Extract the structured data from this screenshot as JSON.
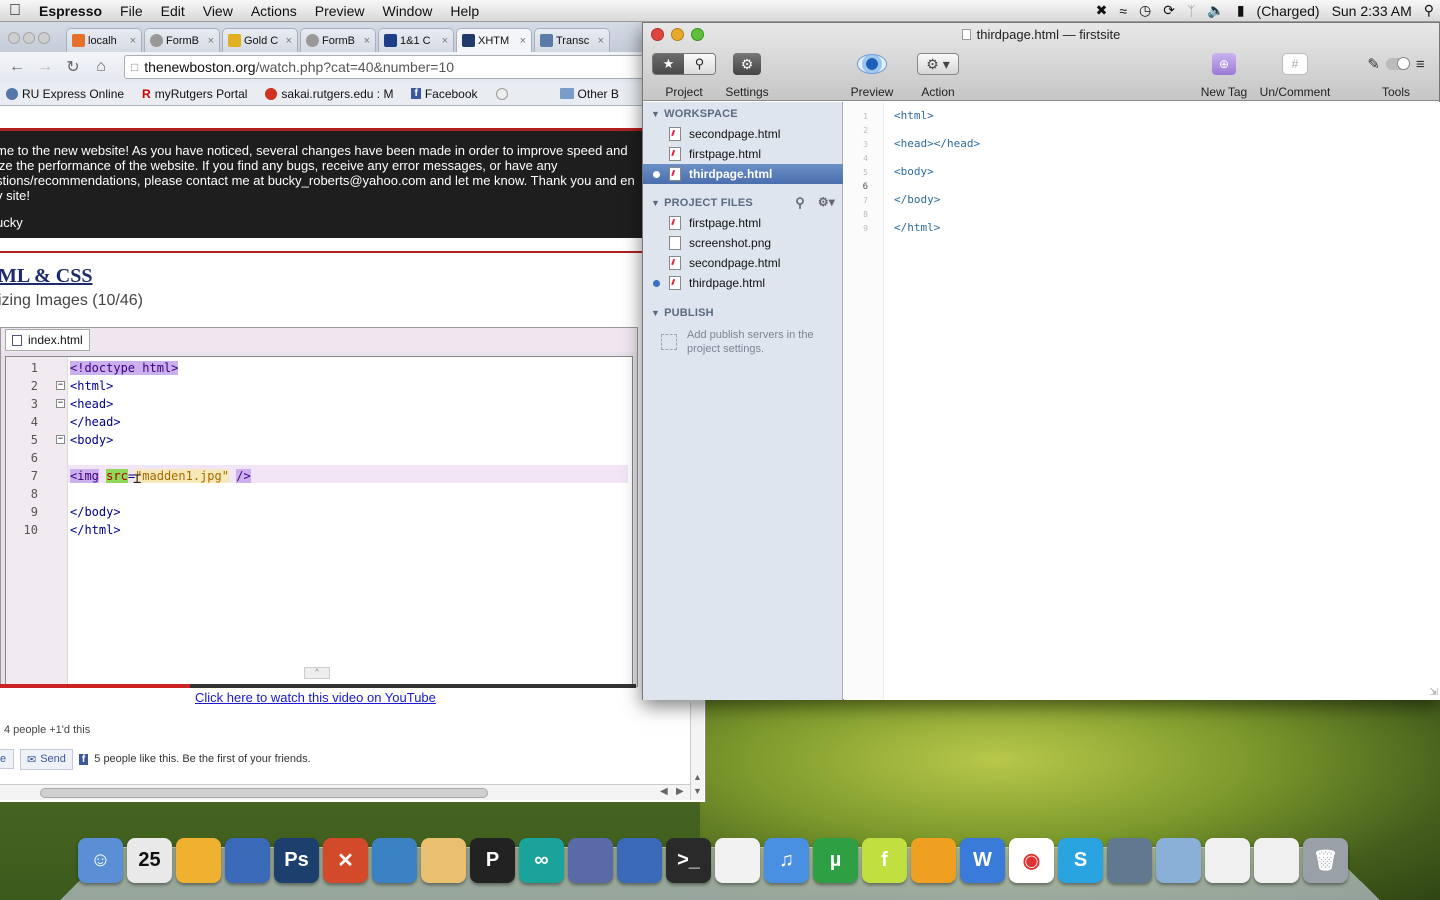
{
  "menubar": {
    "app": "Espresso",
    "items": [
      "File",
      "Edit",
      "View",
      "Actions",
      "Preview",
      "Window",
      "Help"
    ],
    "battery": "(Charged)",
    "clock": "Sun 2:33 AM"
  },
  "browser": {
    "tabs": [
      "localh",
      "FormB",
      "Gold C",
      "FormB",
      "1&1 C",
      "XHTM",
      "Transc"
    ],
    "url_host": "thenewboston.org",
    "url_path": "/watch.php?cat=40&number=10",
    "bookmarks": [
      "RU Express Online",
      "myRutgers Portal",
      "sakai.rutgers.edu : M",
      "Facebook",
      "",
      "Other B"
    ],
    "banner": {
      "lines": [
        "me to the new website! As you have noticed, several changes have been made in order to improve speed and",
        "ize the performance of the website. If you find any bugs, receive any error messages, or have any",
        "stions/recommendations, please contact me at bucky_roberts@yahoo.com and let me know. Thank you and en",
        "v site!"
      ],
      "signature": "ucky"
    },
    "course_title": "ML & CSS",
    "lesson_title": "izing Images (10/46)",
    "video": {
      "tab_label": "index.html",
      "line_numbers": [
        "1",
        "2",
        "3",
        "4",
        "5",
        "6",
        "7",
        "8",
        "9",
        "10"
      ],
      "code": {
        "l1": "<!doctype html>",
        "l2": "<html>",
        "l3": "<head>",
        "l4": "</head>",
        "l5": "<body>",
        "l7_tag": "<img",
        "l7_attr": "src",
        "l7_eq": "=",
        "l7_str": "\"madden1.jpg\"",
        "l7_close": "/>",
        "l9": "</body>",
        "l10": "</html>"
      }
    },
    "youtube_link": "Click here to watch this video on YouTube",
    "plusone_text": "4 people +1'd this",
    "send_label": "Send",
    "like_text": "5 people like this. Be the first of your friends."
  },
  "espresso": {
    "title": "thirdpage.html — firstsite",
    "toolbar": {
      "project": "Project",
      "settings": "Settings",
      "preview": "Preview",
      "action": "Action",
      "new_tag": "New Tag",
      "uncomment": "Un/Comment",
      "tools": "Tools"
    },
    "workspace_label": "WORKSPACE",
    "workspace_files": [
      "secondpage.html",
      "firstpage.html",
      "thirdpage.html"
    ],
    "project_files_label": "PROJECT FILES",
    "project_files": [
      "firstpage.html",
      "screenshot.png",
      "secondpage.html",
      "thirdpage.html"
    ],
    "publish_label": "PUBLISH",
    "publish_note": "Add publish servers in the project settings.",
    "editor_line_numbers": [
      "1",
      "2",
      "3",
      "4",
      "5",
      "6",
      "7",
      "8",
      "9"
    ],
    "editor_code": {
      "l1": "<html>",
      "l3": "<head></head>",
      "l5": "<body>",
      "l7": "</body>",
      "l9": "</html>"
    }
  },
  "dock": {
    "icons": [
      "finder-icon",
      "calendar-icon",
      "preview-icon",
      "imovie-icon",
      "photoshop-icon",
      "xampp-icon",
      "dreamweaver-icon",
      "java-icon",
      "processing-icon",
      "arduino-icon",
      "eclipse-icon",
      "xcode-icon",
      "terminal-icon",
      "textedit-icon",
      "itunes-icon",
      "utorrent-icon",
      "flash-icon",
      "illustrator-icon",
      "word-icon",
      "chrome-icon",
      "skype-icon",
      "camera-icon",
      "folder-icon",
      "document-icon",
      "document-icon-2",
      "trash-icon"
    ],
    "calendar_day": "25",
    "colors": [
      "#5a8fd6",
      "#e9e9e9",
      "#f0b030",
      "#3a6ab8",
      "#1c3f6e",
      "#d24a2a",
      "#3b82c4",
      "#e8c070",
      "#222222",
      "#1aa39a",
      "#5a6aa8",
      "#3a6ab8",
      "#2a2a2a",
      "#f2f2f2",
      "#4a90e2",
      "#2ea043",
      "#c0e040",
      "#f0a020",
      "#3a7ad8",
      "#ffffff",
      "#2aa4e0",
      "#607890",
      "#8ab0d8",
      "#f0f0f0",
      "#f0f0f0",
      "#9aa0a8"
    ]
  }
}
